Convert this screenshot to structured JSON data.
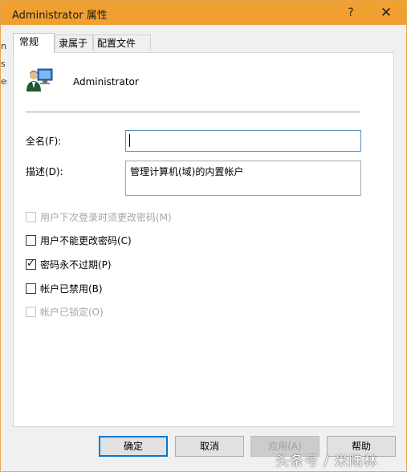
{
  "window": {
    "title": "Administrator 属性",
    "help_glyph": "?",
    "close_glyph": "✕"
  },
  "left_strip": [
    "ni",
    "s",
    "es"
  ],
  "tabs": [
    {
      "label": "常规",
      "active": true
    },
    {
      "label": "隶属于",
      "active": false
    },
    {
      "label": "配置文件",
      "active": false
    }
  ],
  "general": {
    "user_name": "Administrator",
    "user_icon": "user-account-icon",
    "fullname": {
      "label": "全名(F):",
      "value": ""
    },
    "description": {
      "label": "描述(D):",
      "value": "管理计算机(域)的内置帐户"
    }
  },
  "checkboxes": [
    {
      "label": "用户下次登录时须更改密码(M)",
      "checked": false,
      "enabled": false
    },
    {
      "label": "用户不能更改密码(C)",
      "checked": false,
      "enabled": true
    },
    {
      "label": "密码永不过期(P)",
      "checked": true,
      "enabled": true
    },
    {
      "label": "帐户已禁用(B)",
      "checked": false,
      "enabled": true
    },
    {
      "label": "帐户已锁定(O)",
      "checked": false,
      "enabled": false
    }
  ],
  "buttons": {
    "ok": "确定",
    "cancel": "取消",
    "apply": "应用(A)",
    "help": "帮助"
  },
  "watermark": "头条号 / 米陆林",
  "colors": {
    "titlebar": "#f0a030",
    "focus_border": "#0078d7"
  }
}
